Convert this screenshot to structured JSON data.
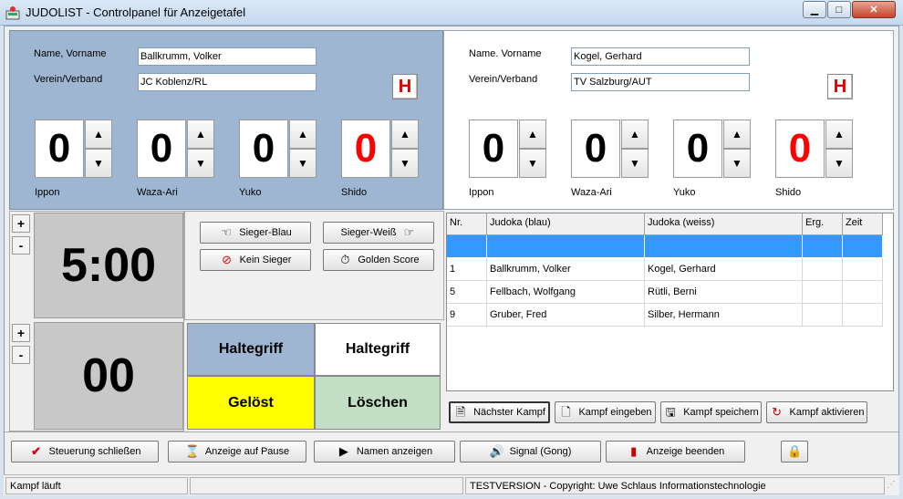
{
  "window": {
    "title": "JUDOLIST - Controlpanel für Anzeigetafel",
    "minimize": "▁",
    "maximize": "□",
    "close": "✕"
  },
  "fighter_blue": {
    "name_label": "Name, Vorname",
    "name_value": "Ballkrumm, Volker",
    "club_label": "Verein/Verband",
    "club_value": "JC Koblenz/RL",
    "h_button": "H",
    "scores": [
      {
        "label": "Ippon",
        "value": "0"
      },
      {
        "label": "Waza-Ari",
        "value": "0"
      },
      {
        "label": "Yuko",
        "value": "0"
      },
      {
        "label": "Shido",
        "value": "0"
      }
    ]
  },
  "fighter_white": {
    "name_label": "Name. Vorname",
    "name_value": "Kogel, Gerhard",
    "club_label": "Verein/Verband",
    "club_value": "TV Salzburg/AUT",
    "h_button": "H",
    "scores": [
      {
        "label": "Ippon",
        "value": "0"
      },
      {
        "label": "Waza-Ari",
        "value": "0"
      },
      {
        "label": "Yuko",
        "value": "0"
      },
      {
        "label": "Shido",
        "value": "0"
      }
    ]
  },
  "timer": {
    "main_time": "5:00",
    "hold_time": "00",
    "plus": "+",
    "minus": "-"
  },
  "decision": {
    "winner_blue": "Sieger-Blau",
    "winner_white": "Sieger-Weiß",
    "no_winner": "Kein Sieger",
    "golden_score": "Golden Score"
  },
  "osaekomi": {
    "hold_blue": "Haltegriff",
    "hold_white": "Haltegriff",
    "released": "Gelöst",
    "clear": "Löschen"
  },
  "grid": {
    "columns": [
      "Nr.",
      "Judoka (blau)",
      "Judoka (weiss)",
      "Erg.",
      "Zeit"
    ],
    "rows": [
      [
        "",
        "",
        "",
        "",
        ""
      ],
      [
        "1",
        "Ballkrumm, Volker",
        "Kogel, Gerhard",
        "",
        ""
      ],
      [
        "5",
        "Fellbach, Wolfgang",
        "Rütli, Berni",
        "",
        ""
      ],
      [
        "9",
        "Gruber, Fred",
        "Silber, Hermann",
        "",
        ""
      ]
    ]
  },
  "fight_buttons": {
    "next": "Nächster Kampf",
    "enter": "Kampf eingeben",
    "save": "Kampf speichern",
    "activate": "Kampf aktivieren"
  },
  "bottom_buttons": {
    "close_control": "Steuerung schließen",
    "pause_display": "Anzeige auf Pause",
    "show_names": "Namen anzeigen",
    "signal": "Signal (Gong)",
    "end_display": "Anzeige beenden"
  },
  "status": {
    "left": "Kampf läuft",
    "right": "TESTVERSION - Copyright: Uwe Schlaus Informationstechnologie"
  },
  "colors": {
    "blue_panel": "#9fb6d2",
    "selection": "#3399ff",
    "released": "#ffff00",
    "clear": "#c2dfc6",
    "shido": "#ff0000"
  }
}
